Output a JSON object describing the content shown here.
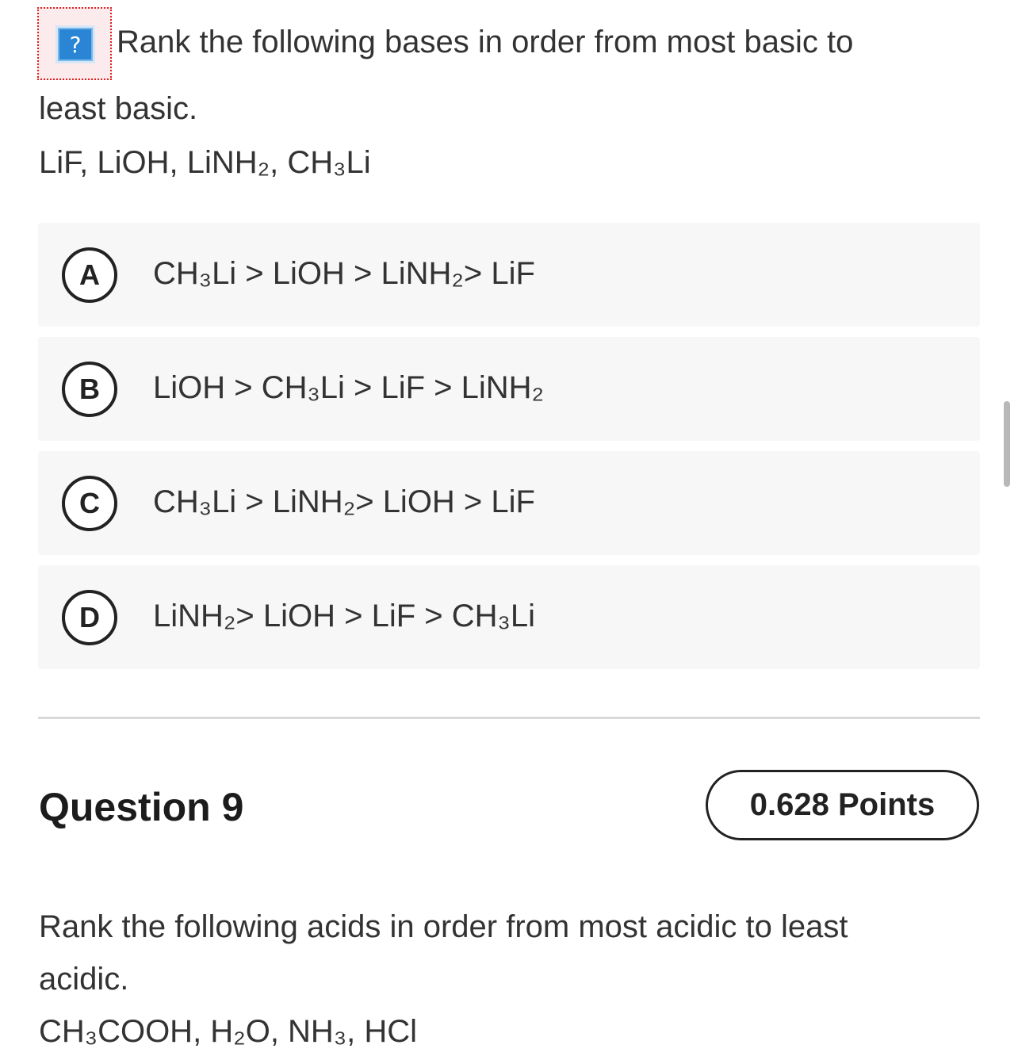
{
  "question8": {
    "help_icon": "question-mark-icon",
    "help_symbol": "?",
    "prompt_line1": "Rank the following bases in order from most basic to",
    "prompt_line2": "least basic.",
    "compounds": "LiF, LiOH, LiNH₂, CH₃Li",
    "options": [
      {
        "letter": "A",
        "text": "CH₃Li > LiOH > LiNH₂> LiF"
      },
      {
        "letter": "B",
        "text": "LiOH > CH₃Li > LiF > LiNH₂"
      },
      {
        "letter": "C",
        "text": "CH₃Li > LiNH₂> LiOH > LiF"
      },
      {
        "letter": "D",
        "text": "LiNH₂> LiOH > LiF > CH₃Li"
      }
    ]
  },
  "question9": {
    "title": "Question 9",
    "points": "0.628 Points",
    "prompt_line1": "Rank the following acids in order from most acidic to least",
    "prompt_line2": "acidic.",
    "compounds": "CH₃COOH, H₂O, NH₃, HCl"
  },
  "colors": {
    "option_bg": "#f7f7f7",
    "help_button": "#2a86d4",
    "help_border": "#e02020",
    "divider": "#d9d9d9"
  }
}
